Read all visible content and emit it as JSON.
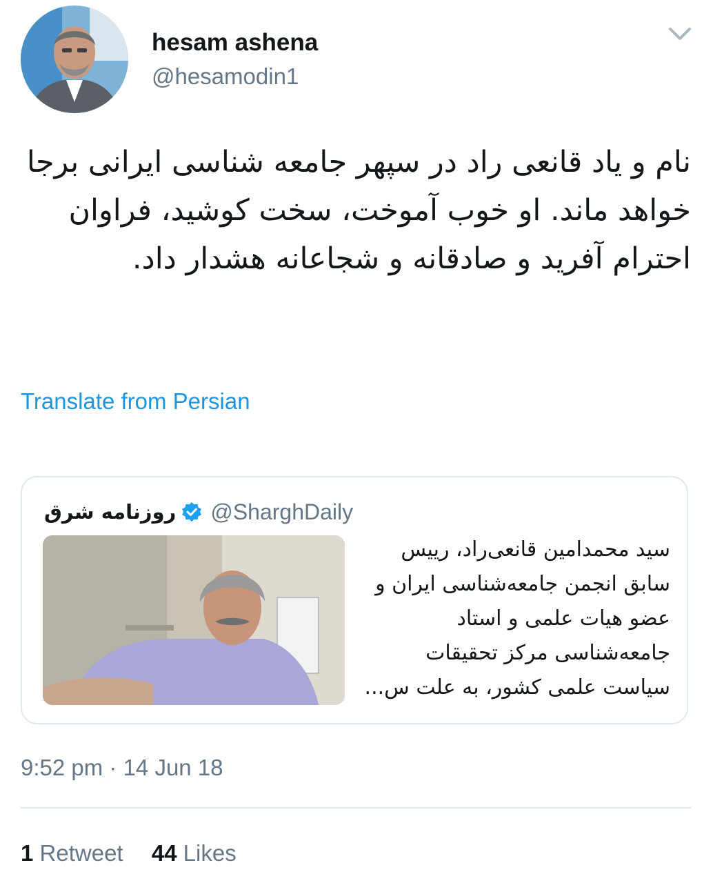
{
  "author": {
    "name": "hesam ashena",
    "handle": "@hesamodin1"
  },
  "tweet": {
    "text": "نام و یاد قانعی راد در سپهر جامعه شناسی ایرانی برجا خواهد ماند. او خوب آموخت، سخت کوشید، فراوان احترام آفرید و صادقانه و شجاعانه هشدار داد.",
    "translate_label": "Translate from Persian"
  },
  "quoted": {
    "name": "روزنامه شرق",
    "verified": true,
    "handle": "@SharghDaily",
    "text": "سید محمدامین قانعی‌راد، رییس سابق انجمن جامعه‌شناسی ایران و عضو هیات علمی و استاد جامعه‌شناسی مرکز تحقیقات سیاست علمی کشور، به علت س..."
  },
  "meta": {
    "timestamp": "9:52 pm · 14 Jun 18"
  },
  "stats": {
    "retweets_count": "1",
    "retweets_label": "Retweet",
    "likes_count": "44",
    "likes_label": "Likes"
  },
  "colors": {
    "link": "#1b95e0",
    "secondary_text": "#657786",
    "border": "#e1e8ed",
    "verified": "#1da1f2"
  }
}
